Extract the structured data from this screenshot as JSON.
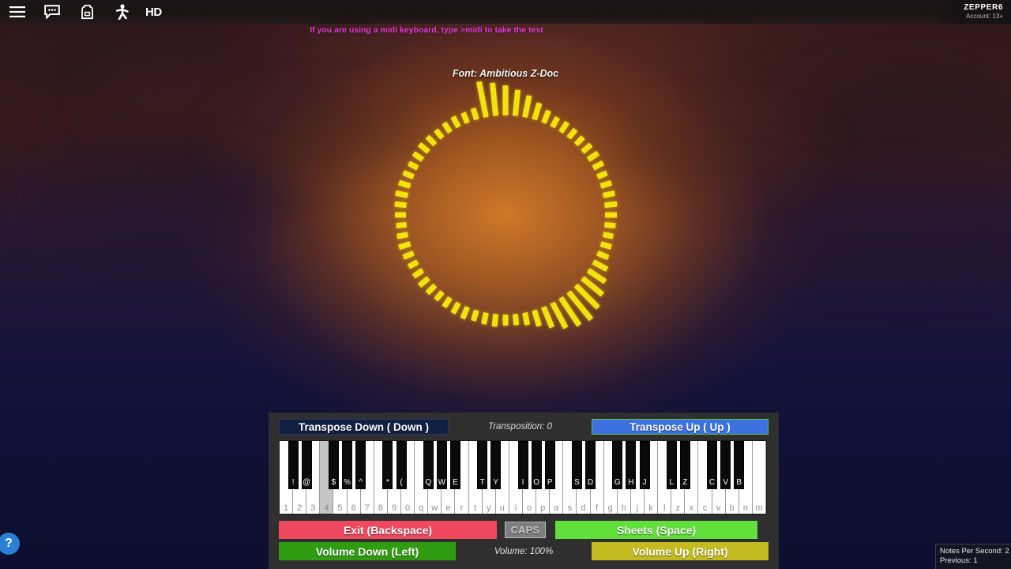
{
  "topbar": {
    "icons": [
      {
        "name": "hamburger-menu-icon",
        "label": "Menu"
      },
      {
        "name": "chat-icon",
        "label": "Chat"
      },
      {
        "name": "backpack-icon",
        "label": "Backpack"
      },
      {
        "name": "emotes-icon",
        "label": "Emotes"
      }
    ],
    "quality_label": "HD",
    "username": "ZEPPER6",
    "account": "Account: 13+"
  },
  "overlay": {
    "midi_hint": "If you are using a midi keyboard, type >midi to take the test",
    "midi_hint_color": "#e83cd6",
    "font_label": "Font: Ambitious Z-Doc"
  },
  "visualizer": {
    "name": "circular-audio-visualizer",
    "bar_color": "#f2e20e",
    "bar_count": 64,
    "bar_lengths": [
      14,
      16,
      15,
      14,
      16,
      15,
      14,
      13,
      14,
      15,
      14,
      13,
      14,
      15,
      14,
      13,
      14,
      15,
      16,
      15,
      14,
      13,
      14,
      15,
      14,
      13,
      14,
      15,
      14,
      15,
      46,
      42,
      38,
      33,
      28,
      22,
      17,
      14,
      15,
      14,
      13,
      14,
      15,
      14,
      13,
      14,
      15,
      16,
      15,
      14,
      13,
      14,
      15,
      20,
      26,
      33,
      40,
      45,
      42,
      36,
      28,
      21,
      16,
      14
    ]
  },
  "piano": {
    "transpose_down_label": "Transpose Down ( Down  )",
    "transposition_label": "Transposition: 0",
    "transpose_up_label": "Transpose Up (  Up  )",
    "exit_label": "Exit (Backspace)",
    "caps_label": "CAPS",
    "sheets_label": "Sheets (Space)",
    "volume_down_label": "Volume Down (Left)",
    "volume_label": "Volume: 100%",
    "volume_up_label": "Volume Up (Right)",
    "colors": {
      "transpose_down": "#122044",
      "transpose_up": "#3b72e0",
      "exit": "#f0495f",
      "caps": "#7e7e7e",
      "sheets": "#61e03c",
      "volume_down": "#2f9c12",
      "volume_up": "#c3bb20"
    },
    "white_keys": [
      {
        "label": "1",
        "pressed": false
      },
      {
        "label": "2",
        "pressed": false
      },
      {
        "label": "3",
        "pressed": false
      },
      {
        "label": "4",
        "pressed": true
      },
      {
        "label": "5",
        "pressed": false
      },
      {
        "label": "6",
        "pressed": false
      },
      {
        "label": "7",
        "pressed": false
      },
      {
        "label": "8",
        "pressed": false
      },
      {
        "label": "9",
        "pressed": false
      },
      {
        "label": "0",
        "pressed": false
      },
      {
        "label": "q",
        "pressed": false
      },
      {
        "label": "w",
        "pressed": false
      },
      {
        "label": "e",
        "pressed": false
      },
      {
        "label": "r",
        "pressed": false
      },
      {
        "label": "t",
        "pressed": false
      },
      {
        "label": "y",
        "pressed": false
      },
      {
        "label": "u",
        "pressed": false
      },
      {
        "label": "i",
        "pressed": false
      },
      {
        "label": "o",
        "pressed": false
      },
      {
        "label": "p",
        "pressed": false
      },
      {
        "label": "a",
        "pressed": false
      },
      {
        "label": "s",
        "pressed": false
      },
      {
        "label": "d",
        "pressed": false
      },
      {
        "label": "f",
        "pressed": false
      },
      {
        "label": "g",
        "pressed": false
      },
      {
        "label": "h",
        "pressed": false
      },
      {
        "label": "j",
        "pressed": false
      },
      {
        "label": "k",
        "pressed": false
      },
      {
        "label": "l",
        "pressed": false
      },
      {
        "label": "z",
        "pressed": false
      },
      {
        "label": "x",
        "pressed": false
      },
      {
        "label": "c",
        "pressed": false
      },
      {
        "label": "v",
        "pressed": false
      },
      {
        "label": "b",
        "pressed": false
      },
      {
        "label": "n",
        "pressed": false
      },
      {
        "label": "m",
        "pressed": false
      }
    ],
    "black_keys": [
      {
        "label": "!",
        "after": 0
      },
      {
        "label": "@",
        "after": 1
      },
      {
        "label": "$",
        "after": 3
      },
      {
        "label": "%",
        "after": 4
      },
      {
        "label": "^",
        "after": 5
      },
      {
        "label": "*",
        "after": 7
      },
      {
        "label": "(",
        "after": 8
      },
      {
        "label": "Q",
        "after": 10
      },
      {
        "label": "W",
        "after": 11
      },
      {
        "label": "E",
        "after": 12
      },
      {
        "label": "T",
        "after": 14
      },
      {
        "label": "Y",
        "after": 15
      },
      {
        "label": "I",
        "after": 17
      },
      {
        "label": "O",
        "after": 18
      },
      {
        "label": "P",
        "after": 19
      },
      {
        "label": "S",
        "after": 21
      },
      {
        "label": "D",
        "after": 22
      },
      {
        "label": "G",
        "after": 24
      },
      {
        "label": "H",
        "after": 25
      },
      {
        "label": "J",
        "after": 26
      },
      {
        "label": "L",
        "after": 28
      },
      {
        "label": "Z",
        "after": 29
      },
      {
        "label": "C",
        "after": 31
      },
      {
        "label": "V",
        "after": 32
      },
      {
        "label": "B",
        "after": 33
      }
    ]
  },
  "stats": {
    "notes_per_second": "Notes Per Second: 2",
    "previous": "Previous: 1"
  },
  "help": {
    "label": "?"
  }
}
